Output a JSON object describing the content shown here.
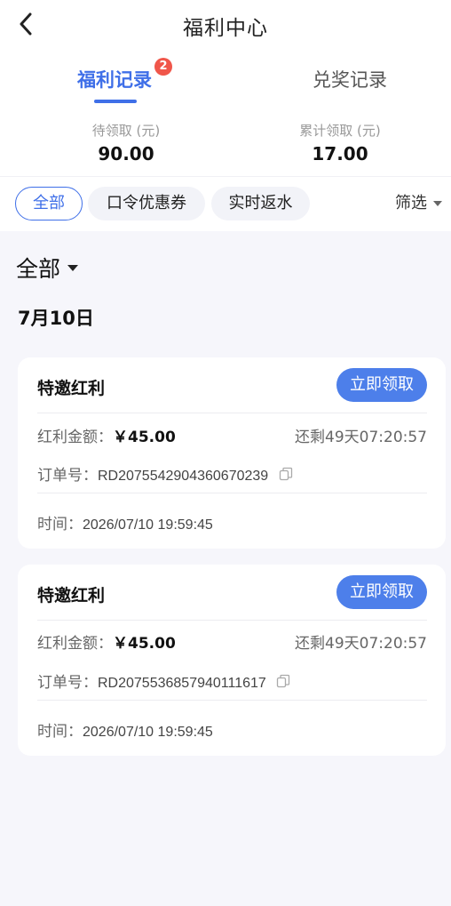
{
  "nav": {
    "title": "福利中心"
  },
  "tabs": [
    {
      "label": "福利记录",
      "badge": "2",
      "active": true
    },
    {
      "label": "兑奖记录",
      "active": false
    }
  ],
  "stats": [
    {
      "label": "待领取 (元)",
      "value": "90.00"
    },
    {
      "label": "累计领取 (元)",
      "value": "17.00"
    }
  ],
  "filters": {
    "chips": [
      "全部",
      "口令优惠券",
      "实时返水"
    ],
    "selected": "全部",
    "filter_label": "筛选"
  },
  "list": {
    "scope_label": "全部",
    "date_header": "7月10日",
    "cards": [
      {
        "title": "特邀红利",
        "button": "立即领取",
        "amount_label": "红利金额：",
        "amount": "￥45.00",
        "remaining": "还剩49天07:20:57",
        "order_label": "订单号：",
        "order_no": "RD20755429043606702​39",
        "time_label": "时间：",
        "time": "2026/07/10 19:59:45"
      },
      {
        "title": "特邀红利",
        "button": "立即领取",
        "amount_label": "红利金额：",
        "amount": "￥45.00",
        "remaining": "还剩49天07:20:57",
        "order_label": "订单号：",
        "order_no": "RD2075536857940111617",
        "time_label": "时间：",
        "time": "2026/07/10 19:59:45"
      }
    ]
  },
  "colors": {
    "accent": "#3f6fe8",
    "button": "#4d7fea",
    "badge": "#f0564a",
    "background": "#f6f6fb"
  }
}
